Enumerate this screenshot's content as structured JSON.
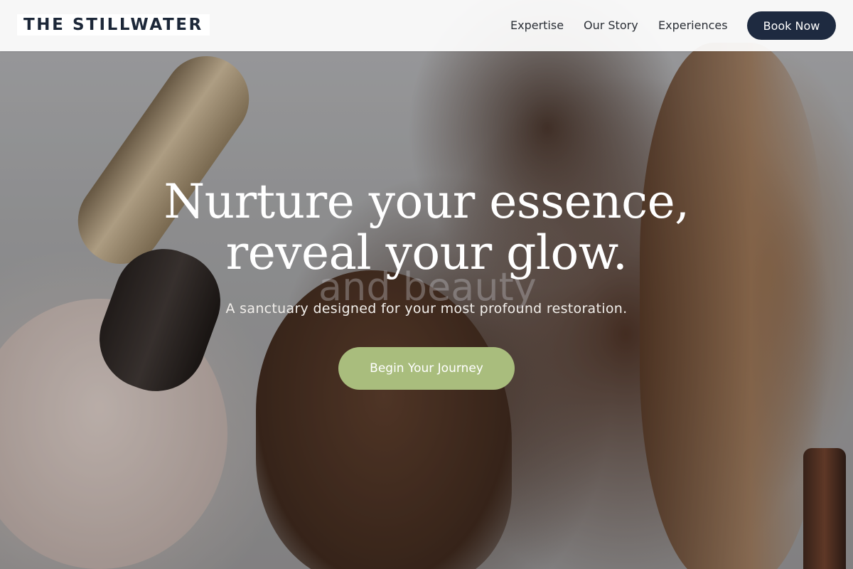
{
  "brand": {
    "name": "THE STILLWATER"
  },
  "nav": {
    "items": [
      {
        "label": "Expertise"
      },
      {
        "label": "Our Story"
      },
      {
        "label": "Experiences"
      }
    ],
    "book_label": "Book Now"
  },
  "hero": {
    "headline": "Nurture your essence, reveal your glow.",
    "ghost_text": "and beauty",
    "subtitle": "A sanctuary designed for your most profound restoration.",
    "cta_label": "Begin Your Journey"
  },
  "colors": {
    "brand_navy": "#1e2a40",
    "accent_sage": "#a9bd7d",
    "text_dark": "#1c2738"
  }
}
